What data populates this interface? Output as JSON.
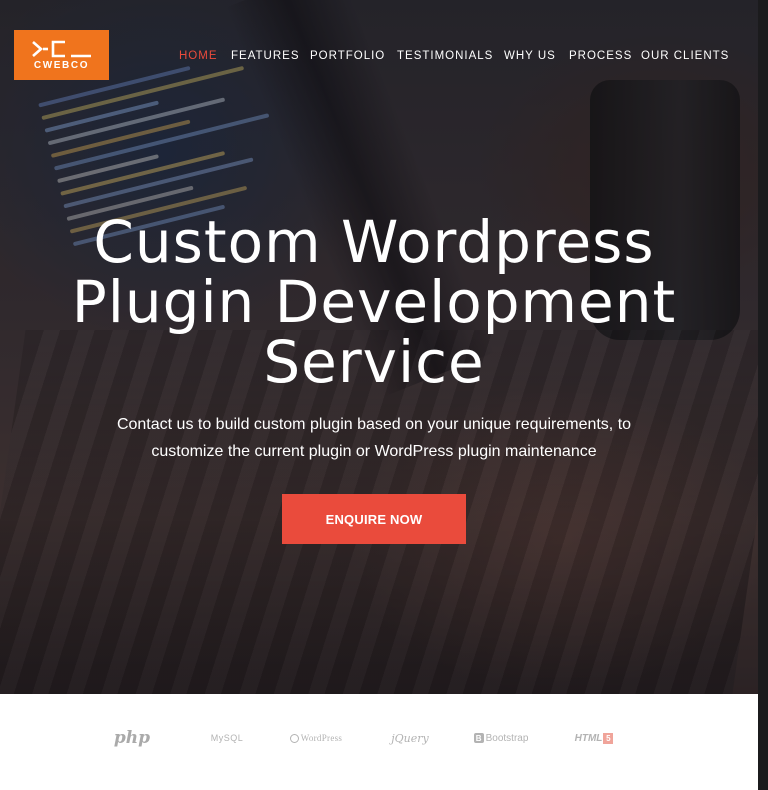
{
  "brand": {
    "logo_text": "CWEBCO",
    "logo_color": "#f0741d"
  },
  "nav": {
    "items": [
      {
        "label": "HOME",
        "active": true
      },
      {
        "label": "FEATURES",
        "active": false
      },
      {
        "label": "PORTFOLIO",
        "active": false
      },
      {
        "label": "TESTIMONIALS",
        "active": false
      },
      {
        "label": "WHY US",
        "active": false
      },
      {
        "label": "PROCESS",
        "active": false
      },
      {
        "label": "OUR CLIENTS",
        "active": false
      }
    ],
    "active_color": "#ea4b3c"
  },
  "hero": {
    "title": "Custom Wordpress Plugin Development Service",
    "subtitle": "Contact us to build custom plugin based on your unique requirements, to customize the current plugin or WordPress plugin maintenance",
    "cta_label": "ENQUIRE NOW",
    "cta_color": "#ea4b3c"
  },
  "tech_logos": {
    "php": "php",
    "mysql": "MySQL",
    "wordpress": "WordPress",
    "jquery": "jQuery",
    "bootstrap": "Bootstrap",
    "bootstrap_mark": "B",
    "html": "HTML",
    "html_mark": "5"
  }
}
